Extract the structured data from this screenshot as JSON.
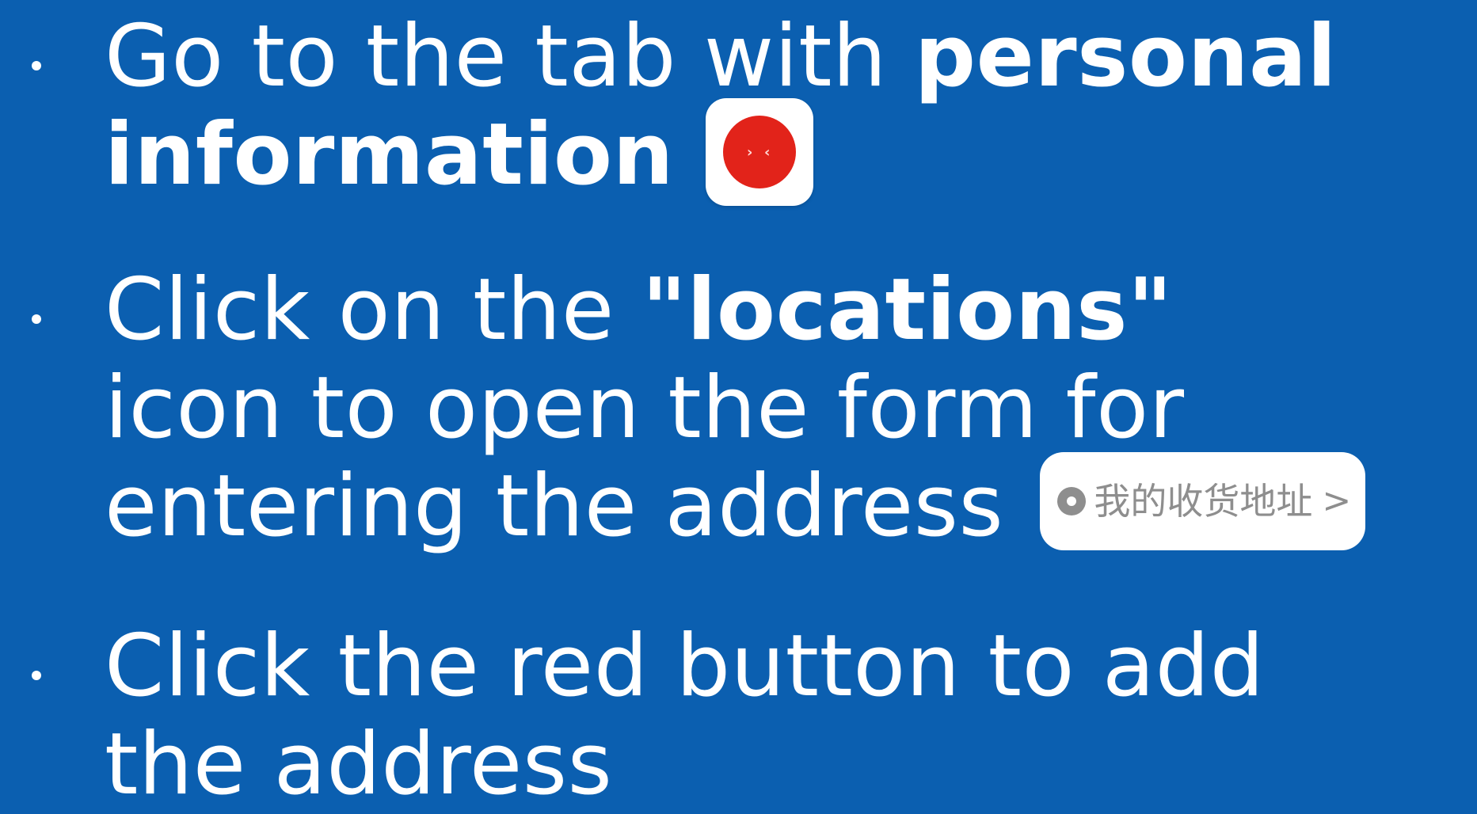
{
  "bullets": [
    {
      "lines": [
        {
          "parts": [
            "Go to the tab with ",
            "personal"
          ]
        },
        {
          "parts": [
            "information"
          ]
        }
      ]
    },
    {
      "lines": [
        {
          "parts": [
            "Click on the ",
            "\"locations\""
          ]
        },
        {
          "parts": [
            "icon to open the form for"
          ]
        },
        {
          "parts": [
            "entering the address"
          ]
        }
      ],
      "location_pill": {
        "icon": "location-pin-icon",
        "label": "我的收货地址",
        "chevron": ">"
      }
    },
    {
      "lines": [
        {
          "parts": [
            "Click the red button to add"
          ]
        },
        {
          "parts": [
            "the address"
          ]
        }
      ]
    }
  ],
  "colors": {
    "background": "#0b5fb0",
    "text": "#ffffff",
    "icon_red": "#e2231a",
    "pill_text": "#8e8e8e"
  }
}
